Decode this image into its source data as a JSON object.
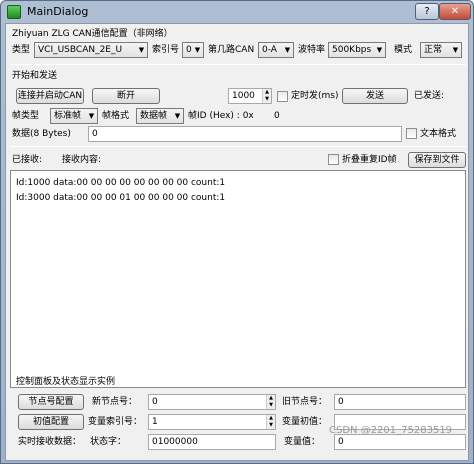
{
  "window": {
    "title": "MainDialog",
    "help_label": "?",
    "close_label": "✕"
  },
  "config": {
    "group_title": "Zhiyuan ZLG CAN通信配置（非网络）",
    "type_label": "类型",
    "type_value": "VCI_USBCAN_2E_U",
    "index_label": "索引号",
    "index_value": "0",
    "channel_label": "第几路CAN",
    "channel_value": "0-A",
    "baud_label": "波特率",
    "baud_value": "500Kbps",
    "mode_label": "模式",
    "mode_value": "正常"
  },
  "send": {
    "group_title": "开始和发送",
    "connect_label": "连接并启动CAN",
    "disconnect_label": "断开",
    "interval_value": "1000",
    "timed_send_label": "定时发(ms)",
    "send_label": "发送",
    "sent_label": "已发送:",
    "frame_type_label": "帧类型",
    "frame_type_value": "标准帧",
    "frame_format_label": "帧格式",
    "frame_format_value": "数据帧",
    "frame_id_label": "帧ID (Hex) : 0x",
    "frame_id_value": "0",
    "data_label": "数据(8 Bytes)",
    "data_value": "0",
    "text_format_label": "文本格式"
  },
  "receive": {
    "received_label": "已接收:",
    "content_label": "接收内容:",
    "fold_label": "折叠重复ID帧",
    "save_label": "保存到文件",
    "log_lines": [
      "Id:1000 data:00 00 00 00 00 00 00 00 count:1",
      "Id:3000 data:00 00 00 01 00 00 00 00 count:1"
    ]
  },
  "control": {
    "group_title": "控制面板及状态显示实例",
    "node_config_label": "节点号配置",
    "new_node_label": "新节点号：",
    "new_node_value": "0",
    "old_node_label": "旧节点号：",
    "old_node_value": "0",
    "init_config_label": "初值配置",
    "var_index_label": "变量索引号：",
    "var_index_value": "1",
    "var_init_label": "变量初值：",
    "var_init_value": "",
    "realtime_label": "实时接收数据：",
    "status_word_label": "状态字：",
    "status_word_value": "01000000",
    "var_value_label": "变量值：",
    "var_value_value": "0"
  },
  "watermark": "CSDN @2201_75283519"
}
